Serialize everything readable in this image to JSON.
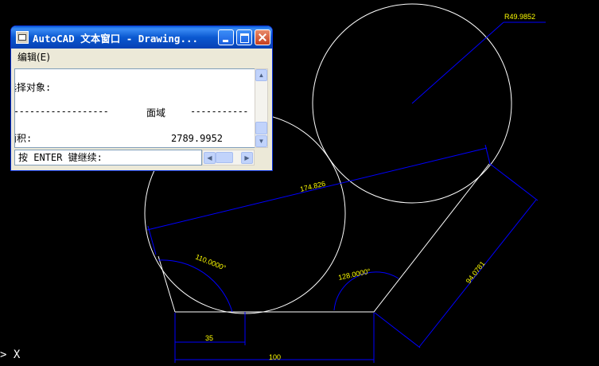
{
  "window": {
    "title": "AutoCAD 文本窗口 - Drawing...",
    "menu_edit": "编辑(E)",
    "lines": [
      "选择对象:",
      "------------------",
      "面域",
      "-----------",
      "面积:",
      "2789.9952"
    ],
    "command_prompt": "按 ENTER 键继续:"
  },
  "drawing": {
    "dim_radius": "R49.9852",
    "dim_diagonal": "174.826",
    "dim_angle_left": "110.0000°",
    "dim_angle_right": "128.0000°",
    "dim_slant": "94.0781",
    "dim_small": "35",
    "dim_bottom": "100"
  },
  "command_line": {
    "prompt": "> X"
  },
  "colors": {
    "drawing_bg": "#000000",
    "geometry": "#ffffff",
    "dimension": "#0000ff",
    "dim_text": "#ffff00"
  }
}
